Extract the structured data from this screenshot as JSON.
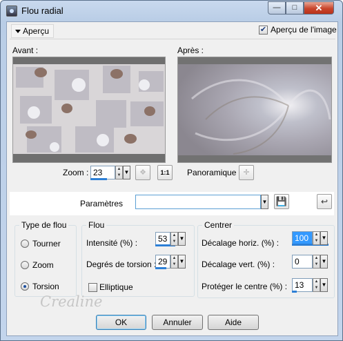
{
  "window": {
    "title": "Flou radial",
    "min": "—",
    "max": "□",
    "close": "✕"
  },
  "apercu": {
    "label": "Aperçu",
    "image_checkbox_label": "Aperçu de l'image",
    "image_checked": true
  },
  "preview": {
    "before_label": "Avant :",
    "after_label": "Après :"
  },
  "zoom": {
    "label": "Zoom :",
    "value": "23",
    "one_to_one": "1:1",
    "pan_label": "Panoramique :"
  },
  "params": {
    "label": "Paramètres",
    "value": ""
  },
  "blur_type": {
    "title": "Type de flou",
    "options": [
      "Tourner",
      "Zoom",
      "Torsion"
    ],
    "selected": "Torsion"
  },
  "flou": {
    "title": "Flou",
    "intensity_label": "Intensité (%) :",
    "intensity_value": "53",
    "intensity_fill": 0.53,
    "torsion_label": "Degrés de torsion :",
    "torsion_value": "29",
    "torsion_fill": 0.29,
    "elliptic_label": "Elliptique",
    "elliptic_checked": false
  },
  "centrer": {
    "title": "Centrer",
    "horiz_label": "Décalage horiz. (%) :",
    "horiz_value": "100",
    "horiz_fill": 1.0,
    "vert_label": "Décalage vert. (%) :",
    "vert_value": "0",
    "vert_fill": 0.0,
    "protect_label": "Protéger le centre (%) :",
    "protect_value": "13",
    "protect_fill": 0.13
  },
  "buttons": {
    "ok": "OK",
    "cancel": "Annuler",
    "help": "Aide"
  },
  "watermark": "Crealine",
  "colors": {
    "accent": "#2c7fd6",
    "close": "#c8452c"
  }
}
